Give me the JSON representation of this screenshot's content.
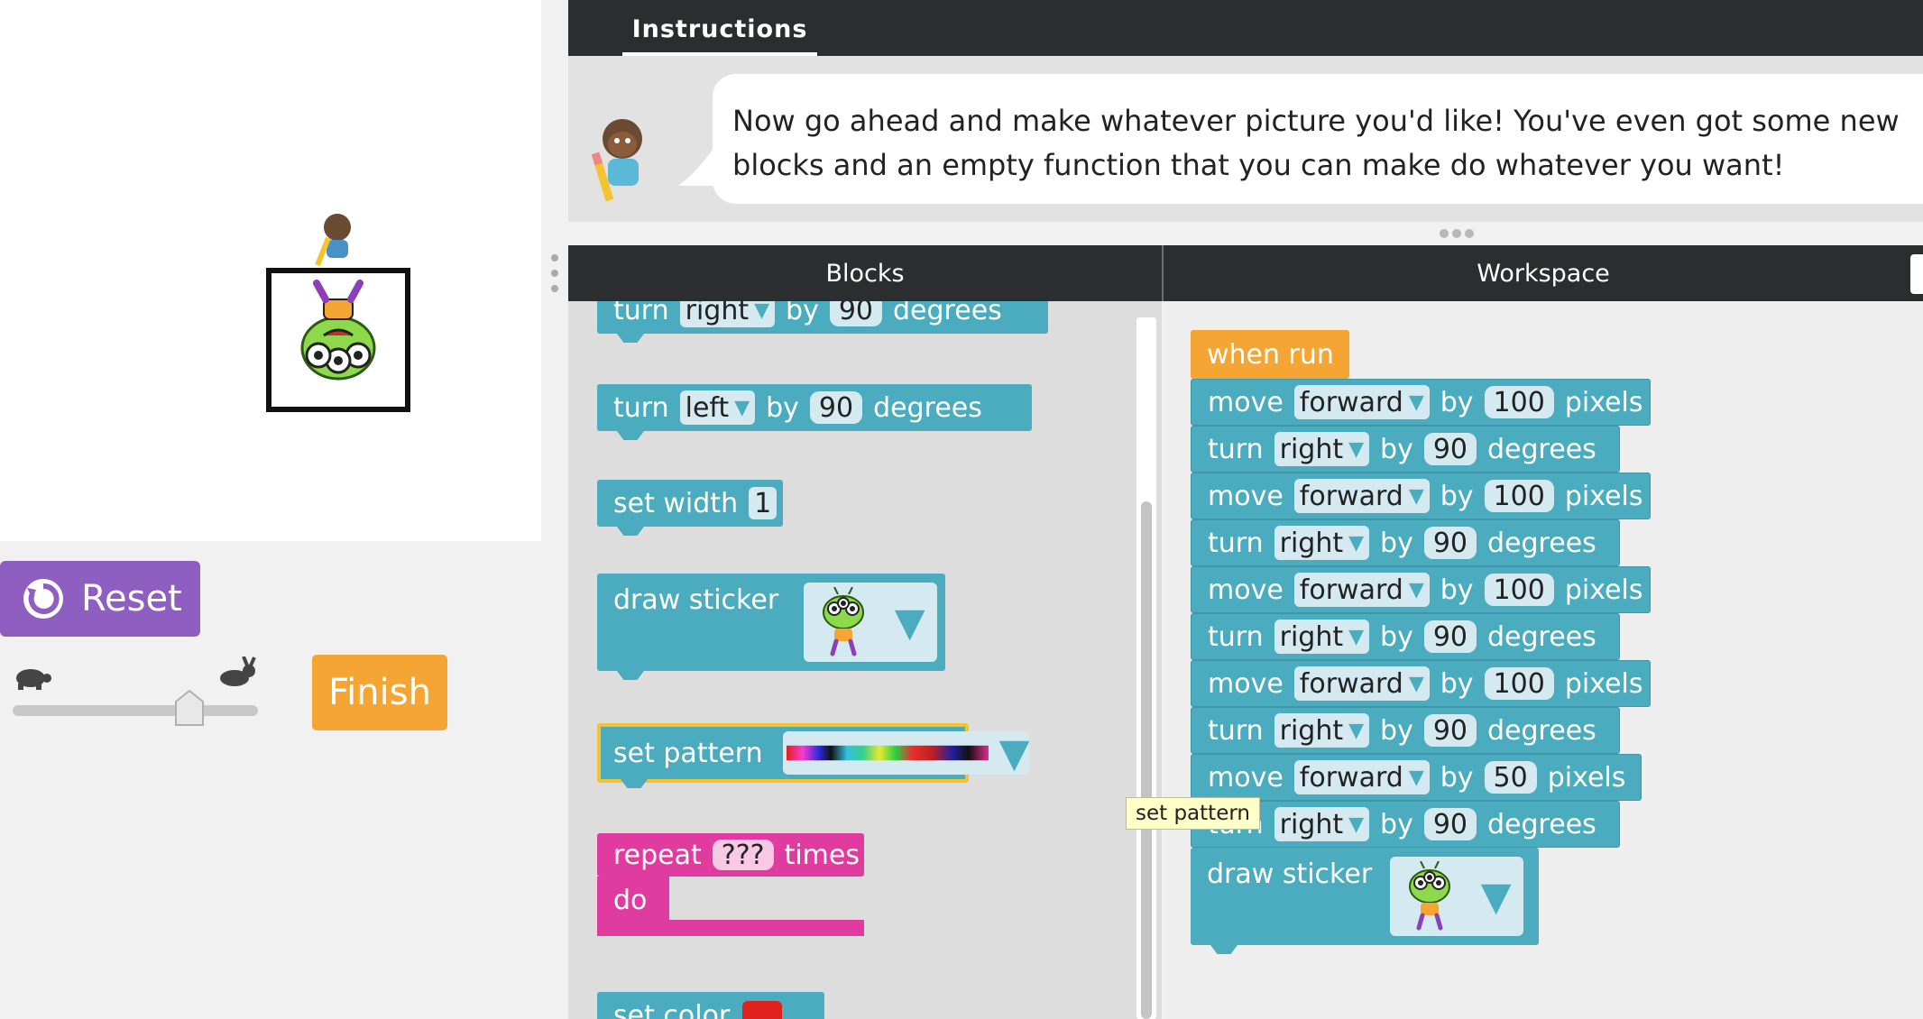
{
  "instructions": {
    "tab_label": "Instructions",
    "text": "Now go ahead and make whatever picture you'd like! You've even got some new blocks and an empty function that you can make do whatever you want!"
  },
  "stage": {
    "reset_label": "Reset",
    "finish_label": "Finish",
    "speed_fraction": 0.72
  },
  "panels": {
    "blocks_label": "Blocks",
    "workspace_label": "Workspace"
  },
  "toolbox": {
    "turn_right": {
      "word1": "turn",
      "dir": "right",
      "word2": "by",
      "value": "90",
      "unit": "degrees"
    },
    "turn_left": {
      "word1": "turn",
      "dir": "left",
      "word2": "by",
      "value": "90",
      "unit": "degrees"
    },
    "set_width": {
      "label": "set width",
      "value": "1"
    },
    "draw_sticker": {
      "label": "draw sticker"
    },
    "set_pattern": {
      "label": "set pattern"
    },
    "repeat": {
      "label": "repeat",
      "value": "???",
      "suffix": "times",
      "do": "do"
    },
    "set_color": {
      "label": "set color",
      "color": "#e0201d"
    }
  },
  "tooltip": "set pattern",
  "workspace": {
    "hat": "when run",
    "blocks": [
      {
        "verb": "move",
        "dir": "forward",
        "by": "by",
        "value": "100",
        "unit": "pixels"
      },
      {
        "verb": "turn",
        "dir": "right",
        "by": "by",
        "value": "90",
        "unit": "degrees"
      },
      {
        "verb": "move",
        "dir": "forward",
        "by": "by",
        "value": "100",
        "unit": "pixels"
      },
      {
        "verb": "turn",
        "dir": "right",
        "by": "by",
        "value": "90",
        "unit": "degrees"
      },
      {
        "verb": "move",
        "dir": "forward",
        "by": "by",
        "value": "100",
        "unit": "pixels"
      },
      {
        "verb": "turn",
        "dir": "right",
        "by": "by",
        "value": "90",
        "unit": "degrees"
      },
      {
        "verb": "move",
        "dir": "forward",
        "by": "by",
        "value": "100",
        "unit": "pixels"
      },
      {
        "verb": "turn",
        "dir": "right",
        "by": "by",
        "value": "90",
        "unit": "degrees"
      },
      {
        "verb": "move",
        "dir": "forward",
        "by": "by",
        "value": "50",
        "unit": "pixels"
      },
      {
        "verb": "turn",
        "dir": "right",
        "by": "by",
        "value": "90",
        "unit": "degrees"
      }
    ],
    "draw_sticker": "draw sticker"
  },
  "icons": {
    "reset": "refresh-icon",
    "slow": "turtle-icon",
    "fast": "rabbit-icon",
    "artist": "artist-character-icon",
    "sticker": "alien-sticker-icon"
  }
}
